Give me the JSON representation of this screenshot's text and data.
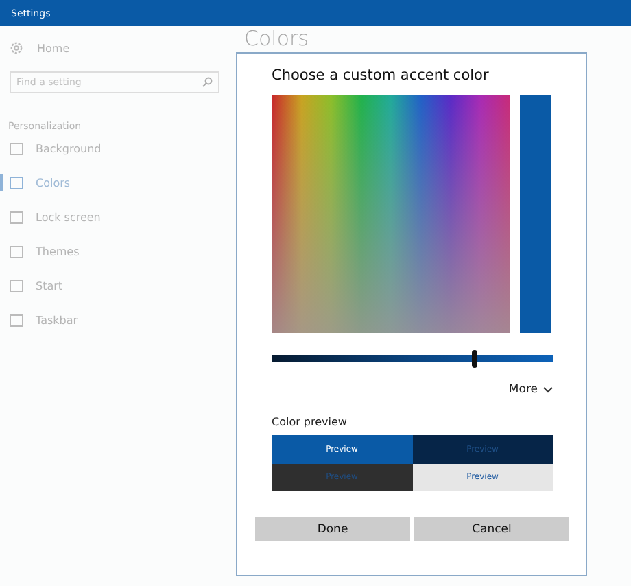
{
  "window": {
    "title": "Settings"
  },
  "sidebar": {
    "home": "Home",
    "search": {
      "placeholder": "Find a setting"
    },
    "section": "Personalization",
    "items": [
      {
        "label": "Background",
        "selected": false
      },
      {
        "label": "Colors",
        "selected": true
      },
      {
        "label": "Lock screen",
        "selected": false
      },
      {
        "label": "Themes",
        "selected": false
      },
      {
        "label": "Start",
        "selected": false
      },
      {
        "label": "Taskbar",
        "selected": false
      }
    ]
  },
  "page": {
    "heading": "Colors"
  },
  "dialog": {
    "title": "Choose a custom accent color",
    "slider": {
      "level": 0.72
    },
    "more": "More",
    "preview_label": "Color preview",
    "previews": [
      {
        "label": "Preview",
        "color": "#0a5aa6",
        "kind": "light"
      },
      {
        "label": "Preview",
        "color": "#062548",
        "kind": "dim"
      },
      {
        "label": "Preview",
        "color": "#2f2f2f",
        "kind": "dim"
      },
      {
        "label": "Preview",
        "color": "#e6e6e6",
        "kind": "accent"
      }
    ],
    "buttons": [
      "Done",
      "Cancel"
    ]
  }
}
